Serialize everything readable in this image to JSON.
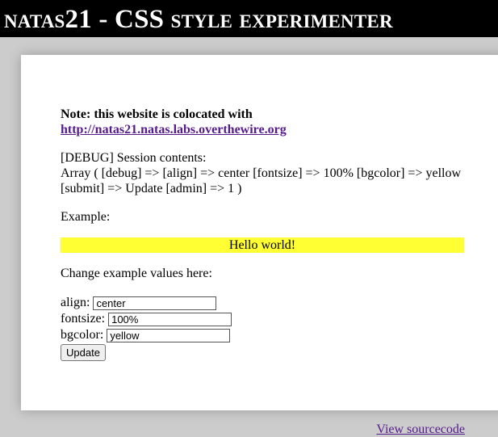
{
  "header": {
    "title": "natas21 - CSS style experimenter"
  },
  "note": {
    "prefix": "Note: this website is colocated with",
    "link_text": "http://natas21.natas.labs.overthewire.org"
  },
  "debug": {
    "label": "[DEBUG] Session contents:",
    "contents": "Array ( [debug] => [align] => center [fontsize] => 100% [bgcolor] => yellow [submit] => Update [admin] => 1 )"
  },
  "example": {
    "label": "Example:",
    "text": "Hello world!",
    "bgcolor": "#ffff33"
  },
  "form": {
    "heading": "Change example values here:",
    "align_label": "align:",
    "align_value": "center",
    "fontsize_label": "fontsize:",
    "fontsize_value": "100%",
    "bgcolor_label": "bgcolor:",
    "bgcolor_value": "yellow",
    "submit_label": "Update"
  },
  "footer": {
    "view_source": "View sourcecode"
  }
}
